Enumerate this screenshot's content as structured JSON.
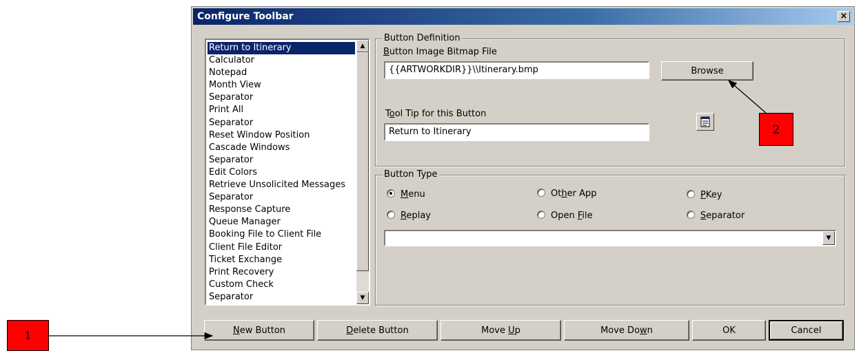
{
  "window": {
    "title": "Configure Toolbar",
    "close_label": "×"
  },
  "list": {
    "selected_index": 0,
    "items": [
      "Return to Itinerary",
      "Calculator",
      "Notepad",
      "Month View",
      "Separator",
      "Print All",
      "Separator",
      "Reset Window Position",
      "Cascade Windows",
      "Separator",
      "Edit Colors",
      "Retrieve Unsolicited Messages",
      "Separator",
      "Response Capture",
      "Queue Manager",
      "Booking File to Client File",
      "Client File Editor",
      "Ticket Exchange",
      "Print Recovery",
      "Custom Check",
      "Separator"
    ]
  },
  "definition": {
    "legend": "Button Definition",
    "image_label": "Button Image Bitmap File",
    "image_value": "{{ARTWORKDIR}}\\\\Itinerary.bmp",
    "browse_label": "Browse",
    "tooltip_label": "Tool Tip for this Button",
    "tooltip_value": "Return to Itinerary"
  },
  "button_type": {
    "legend": "Button Type",
    "options": [
      {
        "label": "Menu",
        "checked": true
      },
      {
        "label": "Other App",
        "checked": false
      },
      {
        "label": "PKey",
        "checked": false
      },
      {
        "label": "Replay",
        "checked": false
      },
      {
        "label": "Open File",
        "checked": false
      },
      {
        "label": "Separator",
        "checked": false
      }
    ],
    "combo_value": ""
  },
  "buttons": {
    "new": "New Button",
    "delete": "Delete Button",
    "move_up": "Move Up",
    "move_down": "Move Down",
    "ok": "OK",
    "cancel": "Cancel"
  },
  "callouts": {
    "one": "1",
    "two": "2"
  },
  "colors": {
    "callout": "#ff0000",
    "titlebar": "#0a246a",
    "dialog": "#d4d0c8"
  }
}
